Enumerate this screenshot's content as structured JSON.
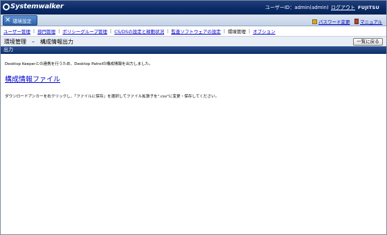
{
  "header": {
    "logo_text": "Systemwalker",
    "user_label": "ユーザーID：admin(admin)",
    "logout_label": "ログアウト",
    "brand": "FUJITSU"
  },
  "tabstrip": {
    "env_tab_label": "環境設定",
    "password_change_label": "パスワード変更",
    "manual_label": "マニュアル"
  },
  "menu": {
    "items": [
      {
        "label": "ユーザー管理",
        "current": false
      },
      {
        "label": "部門管理",
        "current": false
      },
      {
        "label": "ポリシーグループ管理",
        "current": false
      },
      {
        "label": "CS/DSの設定と稼動状況",
        "current": false
      },
      {
        "label": "監査ソフトウェアの設定",
        "current": false
      },
      {
        "label": "環境管理",
        "current": true
      },
      {
        "label": "オプション",
        "current": false
      }
    ]
  },
  "page": {
    "title": "環境管理　–　構成情報出力",
    "back_button_label": "一覧に戻る",
    "section_label": "出力"
  },
  "content": {
    "message": "Desktop Keeperとの連携を行うため、Desktop Patrolの構成情報を出力しました。",
    "file_link": "構成情報ファイル",
    "instruction": "ダウンロードアンカーを右クリックし、「ファイルに保存」を選択してファイル拡張子を\".csv\"に変更・保存してください。"
  },
  "colors": {
    "header_bg": "#0a2a66",
    "link": "#0000cc",
    "tab_active": "#2f63a8"
  }
}
